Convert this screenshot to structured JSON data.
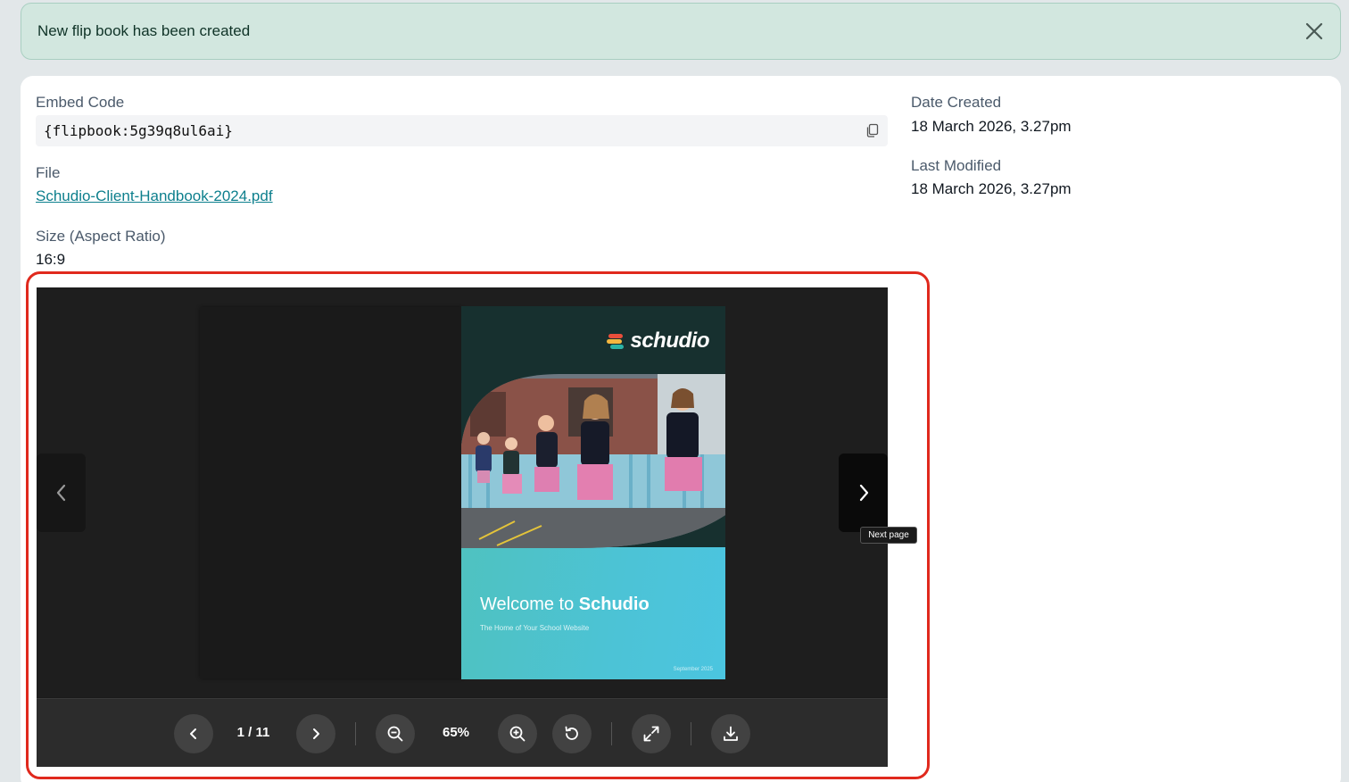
{
  "alert": {
    "message": "New flip book has been created",
    "close_icon": "close-icon"
  },
  "details": {
    "embed_code_label": "Embed Code",
    "embed_code": "{flipbook:5g39q8ul6ai}",
    "file_label": "File",
    "file_name": "Schudio-Client-Handbook-2024.pdf",
    "size_label": "Size (Aspect Ratio)",
    "size_value": "16:9",
    "date_created_label": "Date Created",
    "date_created": "18 March 2026, 3.27pm",
    "last_modified_label": "Last Modified",
    "last_modified": "18 March 2026, 3.27pm"
  },
  "viewer": {
    "cover": {
      "logo_text": "schudio",
      "welcome_prefix": "Welcome to ",
      "welcome_brand": "Schudio",
      "subtitle": "The Home of Your School Website",
      "date": "September 2025"
    },
    "tooltip": "Next page",
    "page_indicator": "1 / 11",
    "zoom": "65%"
  },
  "colors": {
    "alert_bg": "#d2e7df",
    "link": "#0d7f8d",
    "highlight_frame": "#e0291d",
    "viewer_bg": "#1e1e1e",
    "cover_dark": "#17302f",
    "cover_teal": "#4cc3d6"
  }
}
